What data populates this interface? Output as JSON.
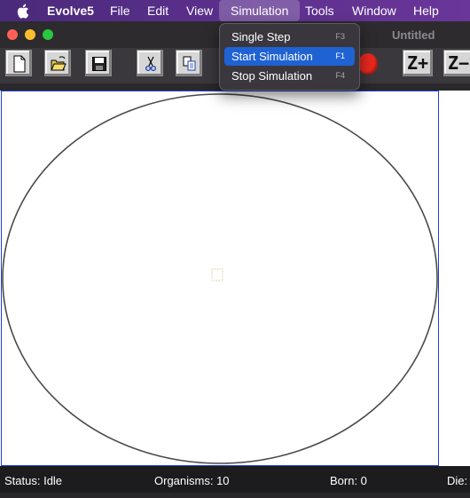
{
  "menubar": {
    "app_name": "Evolve5",
    "items": [
      "File",
      "Edit",
      "View",
      "Simulation",
      "Tools",
      "Window",
      "Help"
    ],
    "active": "Simulation"
  },
  "window": {
    "title": "Untitled"
  },
  "toolbar": {
    "buttons": [
      "new-document",
      "open-folder",
      "save",
      "cut",
      "copy",
      "record"
    ],
    "zoom_in_label": "Z+",
    "zoom_out_label": "Z−"
  },
  "simulation_menu": {
    "items": [
      {
        "label": "Single Step",
        "shortcut": "F3",
        "highlighted": false
      },
      {
        "label": "Start Simulation",
        "shortcut": "F1",
        "highlighted": true
      },
      {
        "label": "Stop Simulation",
        "shortcut": "F4",
        "highlighted": false
      }
    ]
  },
  "status": {
    "status_text": "Status: Idle",
    "organisms_text": "Organisms: 10",
    "born_text": "Born: 0",
    "died_text": "Die:"
  },
  "colors": {
    "menubar": "#5a2f8c",
    "highlight": "#1f62d3",
    "canvas_border": "#1f3fd6",
    "record": "#e8281e"
  }
}
